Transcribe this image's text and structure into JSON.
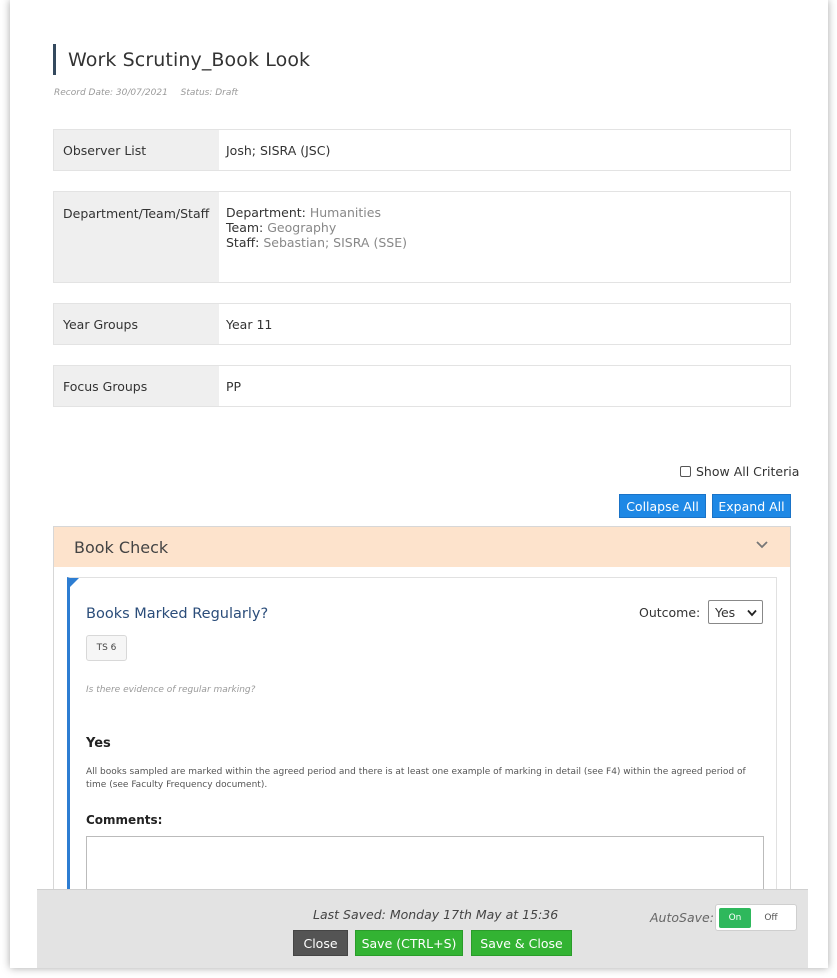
{
  "header": {
    "title": "Work Scrutiny_Book Look",
    "record_date": "Record Date: 30/07/2021",
    "status": "Status: Draft"
  },
  "info": {
    "observer_label": "Observer List",
    "observer_value": "Josh; SISRA (JSC)",
    "dept_label": "Department/Team/Staff",
    "dept_key": "Department:",
    "dept_value": "Humanities",
    "team_key": "Team:",
    "team_value": "Geography",
    "staff_key": "Staff:",
    "staff_value": "Sebastian; SISRA (SSE)",
    "year_label": "Year Groups",
    "year_value": "Year 11",
    "focus_label": "Focus Groups",
    "focus_value": "PP"
  },
  "controls": {
    "show_all_label": "Show All Criteria",
    "collapse_all": "Collapse All",
    "expand_all": "Expand All"
  },
  "section": {
    "title": "Book Check"
  },
  "criterion": {
    "title": "Books Marked Regularly?",
    "outcome_label": "Outcome:",
    "outcome_value": "Yes",
    "tag": "TS 6",
    "question": "Is there evidence of regular marking?",
    "answer_title": "Yes",
    "answer_desc": "All books sampled are marked within the agreed period and there is at least one example of marking in detail (see F4) within the agreed period of time (see Faculty Frequency document).",
    "comments_label": "Comments:"
  },
  "footer": {
    "last_saved": "Last Saved: Monday 17th May at 15:36",
    "autosave_label": "AutoSave:",
    "toggle_on": "On",
    "toggle_off": "Off",
    "close": "Close",
    "save": "Save (CTRL+S)",
    "save_close": "Save & Close"
  },
  "colors": {
    "accent_blue": "#1e88e5",
    "section_header": "#fde3cc",
    "save_green": "#33b333",
    "toggle_green": "#2eb85c"
  }
}
